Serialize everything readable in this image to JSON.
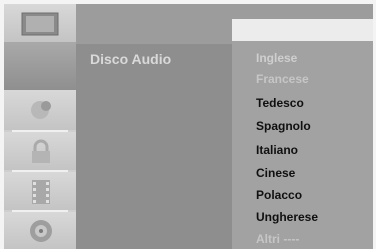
{
  "menu": {
    "heading": "Disco Audio",
    "selected_value": "",
    "options": [
      {
        "label": "Inglese",
        "state": "faded"
      },
      {
        "label": "Francese",
        "state": "dim"
      },
      {
        "label": "Tedesco",
        "state": "normal"
      },
      {
        "label": "Spagnolo",
        "state": "normal"
      },
      {
        "label": "Italiano",
        "state": "normal"
      },
      {
        "label": "Cinese",
        "state": "normal"
      },
      {
        "label": "Polacco",
        "state": "normal"
      },
      {
        "label": "Ungherese",
        "state": "normal"
      },
      {
        "label": "Altri ----",
        "state": "dim"
      }
    ]
  },
  "sidebar": {
    "icons": [
      "general-icon",
      "language-icon",
      "audio-icon",
      "lock-icon",
      "film-icon",
      "disc-icon"
    ]
  }
}
